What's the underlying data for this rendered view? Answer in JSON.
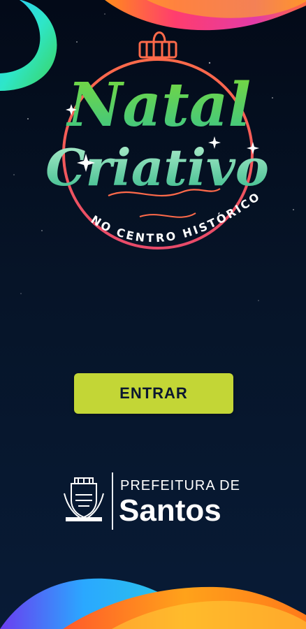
{
  "logo": {
    "line1": "Natal",
    "line2": "Criativo",
    "subtitle": "NO CENTRO HISTÓRICO"
  },
  "actions": {
    "enter_label": "ENTRAR"
  },
  "footer": {
    "prefeitura_line1": "PREFEITURA DE",
    "prefeitura_line2": "Santos"
  },
  "colors": {
    "background": "#061428",
    "button": "#c3d636",
    "button_text": "#0b1730",
    "ornament_ring": "#f06a4a",
    "title_green": "#7ed957"
  }
}
